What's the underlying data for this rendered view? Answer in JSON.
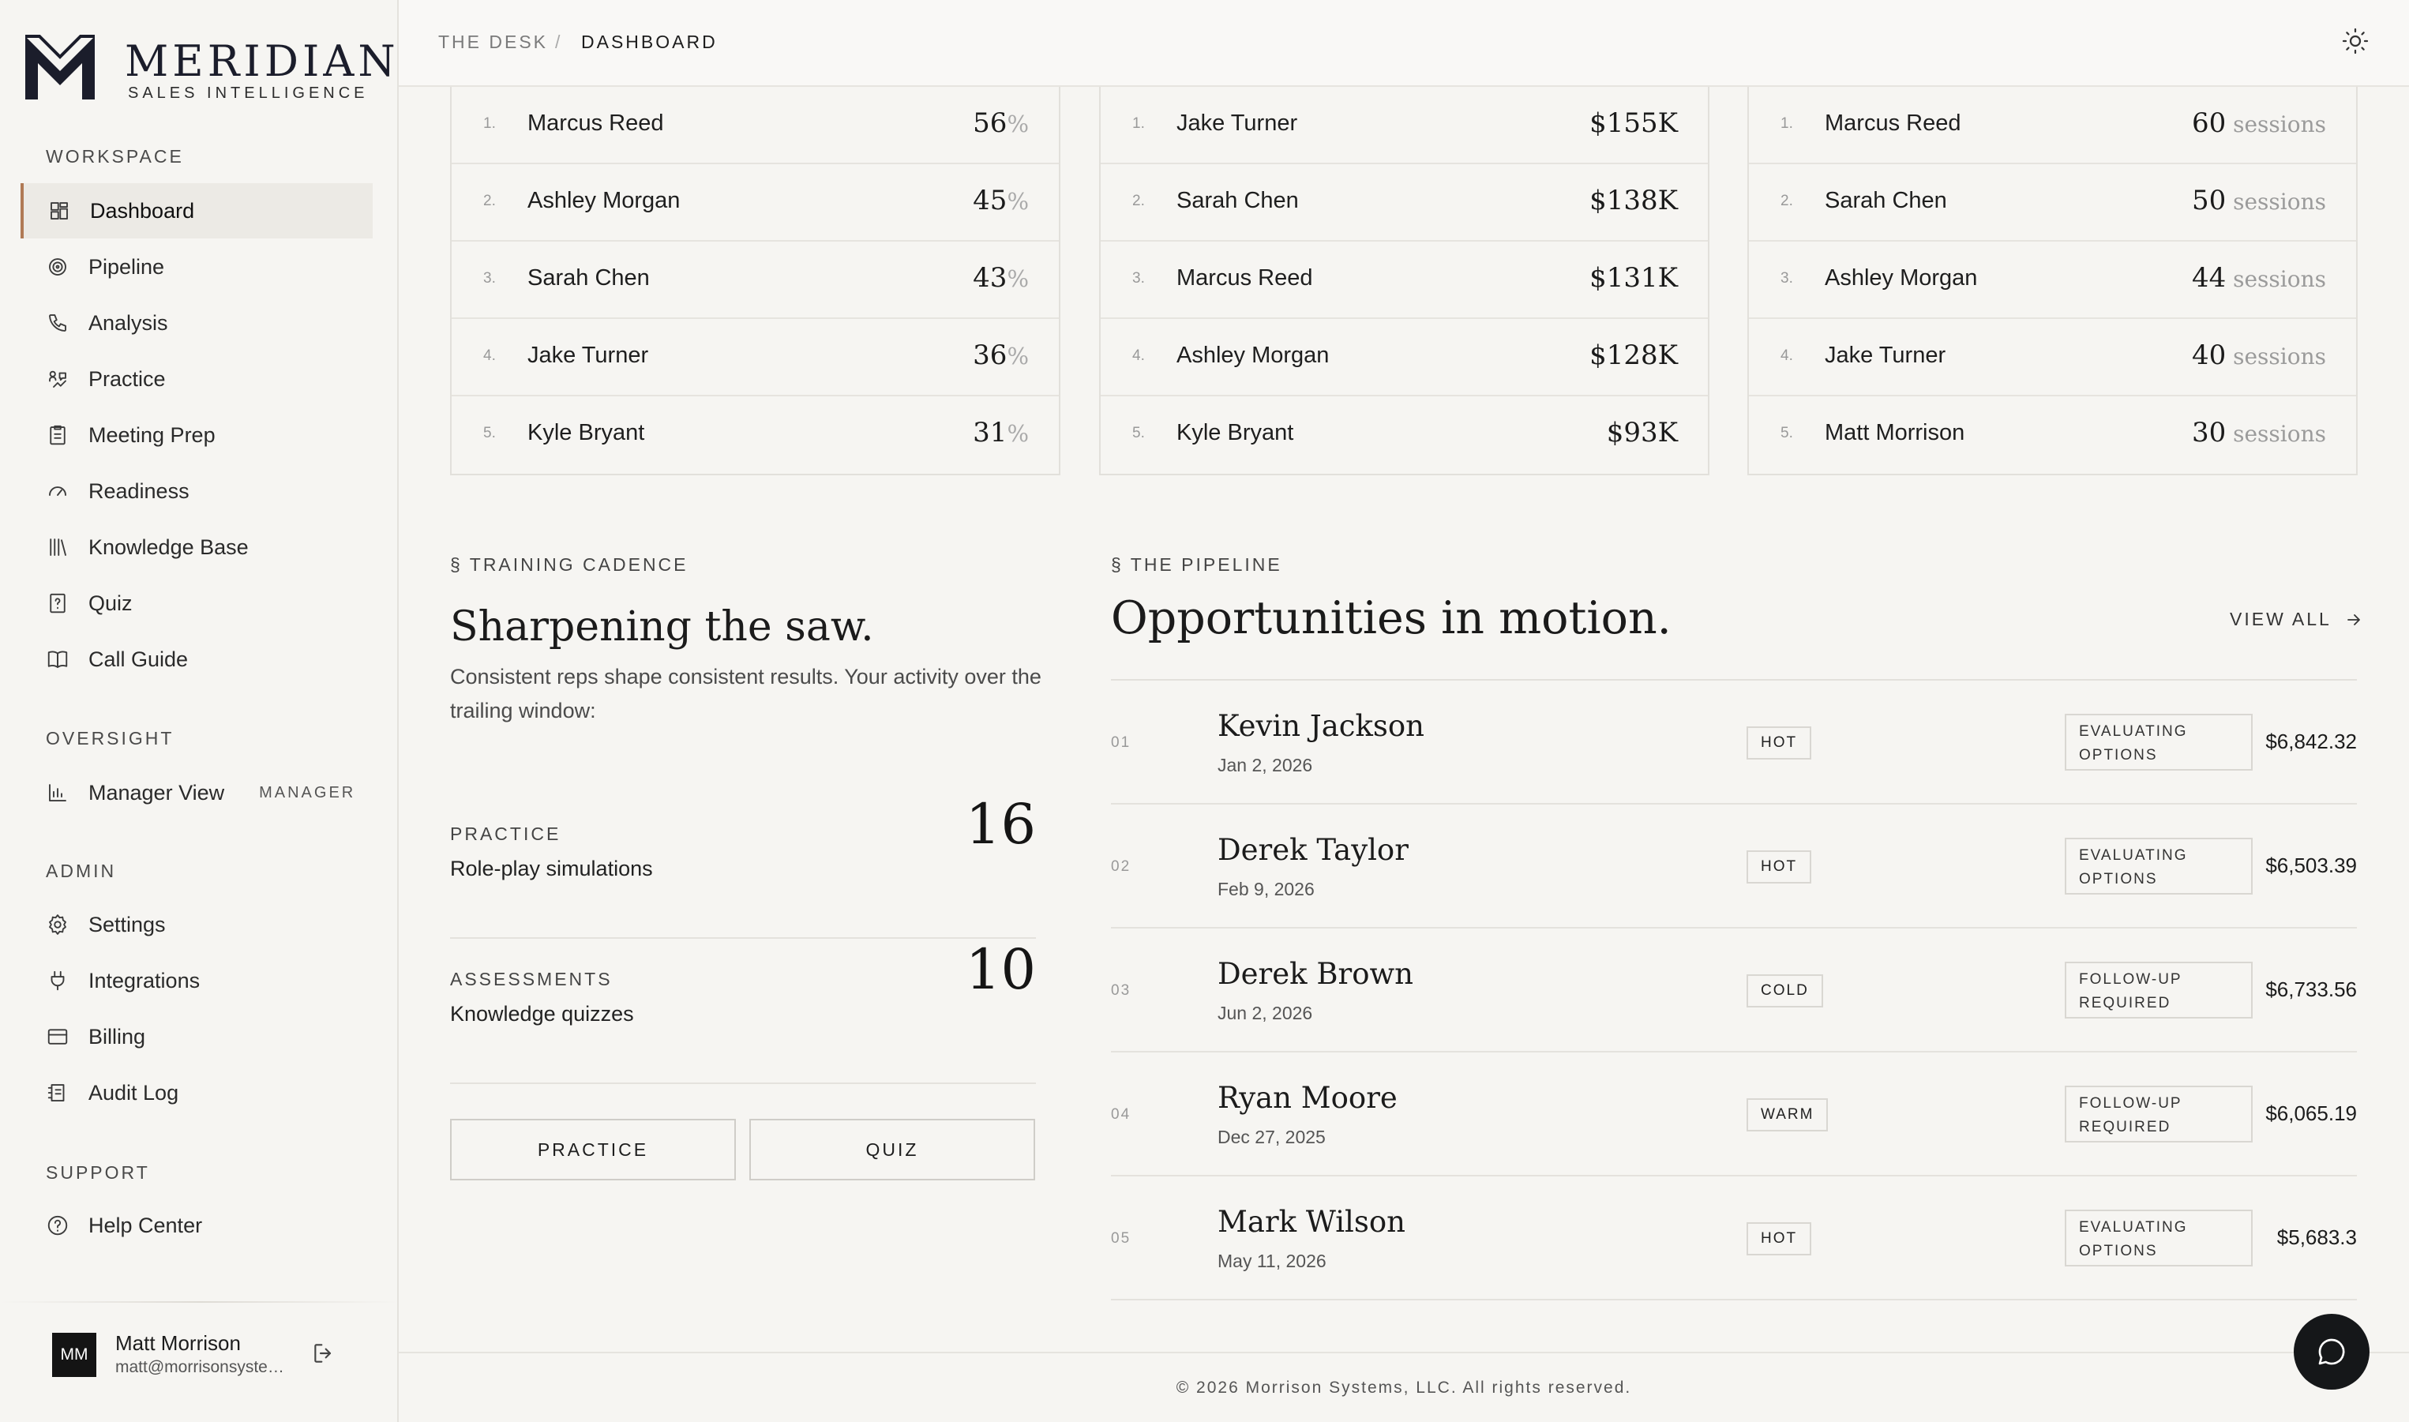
{
  "brand": {
    "name": "MERIDIAN",
    "tagline": "SALES INTELLIGENCE"
  },
  "sidebar": {
    "workspace_label": "WORKSPACE",
    "workspace": [
      {
        "label": "Dashboard",
        "icon": "dashboard-icon",
        "active": true
      },
      {
        "label": "Pipeline",
        "icon": "target-icon"
      },
      {
        "label": "Analysis",
        "icon": "phone-icon"
      },
      {
        "label": "Practice",
        "icon": "practice-icon"
      },
      {
        "label": "Meeting Prep",
        "icon": "clipboard-icon"
      },
      {
        "label": "Readiness",
        "icon": "gauge-icon"
      },
      {
        "label": "Knowledge Base",
        "icon": "library-icon"
      },
      {
        "label": "Quiz",
        "icon": "quiz-icon"
      },
      {
        "label": "Call Guide",
        "icon": "book-icon"
      }
    ],
    "oversight_label": "OVERSIGHT",
    "oversight": [
      {
        "label": "Manager View",
        "icon": "bar-chart-icon",
        "badge": "MANAGER"
      }
    ],
    "admin_label": "ADMIN",
    "admin": [
      {
        "label": "Settings",
        "icon": "gear-icon"
      },
      {
        "label": "Integrations",
        "icon": "plug-icon"
      },
      {
        "label": "Billing",
        "icon": "credit-card-icon"
      },
      {
        "label": "Audit Log",
        "icon": "audit-log-icon"
      }
    ],
    "support_label": "SUPPORT",
    "support": [
      {
        "label": "Help Center",
        "icon": "help-icon"
      }
    ],
    "user": {
      "initials": "MM",
      "name": "Matt Morrison",
      "email": "matt@morrisonsystems.com"
    }
  },
  "topbar": {
    "crumb_root": "THE DESK",
    "separator": "/",
    "crumb_current": "DASHBOARD",
    "theme_icon": "sun-icon"
  },
  "leaderboards": [
    {
      "rows": [
        {
          "rank": "1.",
          "name": "Marcus Reed",
          "value": "56",
          "unit": "%"
        },
        {
          "rank": "2.",
          "name": "Ashley Morgan",
          "value": "45",
          "unit": "%"
        },
        {
          "rank": "3.",
          "name": "Sarah Chen",
          "value": "43",
          "unit": "%"
        },
        {
          "rank": "4.",
          "name": "Jake Turner",
          "value": "36",
          "unit": "%"
        },
        {
          "rank": "5.",
          "name": "Kyle Bryant",
          "value": "31",
          "unit": "%"
        }
      ]
    },
    {
      "rows": [
        {
          "rank": "1.",
          "name": "Jake Turner",
          "value": "$155K",
          "unit": ""
        },
        {
          "rank": "2.",
          "name": "Sarah Chen",
          "value": "$138K",
          "unit": ""
        },
        {
          "rank": "3.",
          "name": "Marcus Reed",
          "value": "$131K",
          "unit": ""
        },
        {
          "rank": "4.",
          "name": "Ashley Morgan",
          "value": "$128K",
          "unit": ""
        },
        {
          "rank": "5.",
          "name": "Kyle Bryant",
          "value": "$93K",
          "unit": ""
        }
      ]
    },
    {
      "rows": [
        {
          "rank": "1.",
          "name": "Marcus Reed",
          "value": "60",
          "unit": " sessions"
        },
        {
          "rank": "2.",
          "name": "Sarah Chen",
          "value": "50",
          "unit": " sessions"
        },
        {
          "rank": "3.",
          "name": "Ashley Morgan",
          "value": "44",
          "unit": " sessions"
        },
        {
          "rank": "4.",
          "name": "Jake Turner",
          "value": "40",
          "unit": " sessions"
        },
        {
          "rank": "5.",
          "name": "Matt Morrison",
          "value": "30",
          "unit": " sessions"
        }
      ]
    }
  ],
  "training": {
    "eyebrow": "§ TRAINING CADENCE",
    "title": "Sharpening the saw.",
    "body": "Consistent reps shape consistent results. Your activity over the trailing window:",
    "metrics": [
      {
        "label": "PRACTICE",
        "desc": "Role-play simulations",
        "value": "16"
      },
      {
        "label": "ASSESSMENTS",
        "desc": "Knowledge quizzes",
        "value": "10"
      }
    ],
    "practice_button": "PRACTICE",
    "quiz_button": "QUIZ"
  },
  "pipeline": {
    "eyebrow": "§ THE PIPELINE",
    "title": "Opportunities in motion.",
    "view_all": "VIEW ALL",
    "rows": [
      {
        "idx": "01",
        "name": "Kevin Jackson",
        "date": "Jan 2, 2026",
        "temp": "HOT",
        "status": "EVALUATING OPTIONS",
        "amount": "$6,842.32"
      },
      {
        "idx": "02",
        "name": "Derek Taylor",
        "date": "Feb 9, 2026",
        "temp": "HOT",
        "status": "EVALUATING OPTIONS",
        "amount": "$6,503.39"
      },
      {
        "idx": "03",
        "name": "Derek Brown",
        "date": "Jun 2, 2026",
        "temp": "COLD",
        "status": "FOLLOW-UP REQUIRED",
        "amount": "$6,733.56"
      },
      {
        "idx": "04",
        "name": "Ryan Moore",
        "date": "Dec 27, 2025",
        "temp": "WARM",
        "status": "FOLLOW-UP REQUIRED",
        "amount": "$6,065.19"
      },
      {
        "idx": "05",
        "name": "Mark Wilson",
        "date": "May 11, 2026",
        "temp": "HOT",
        "status": "EVALUATING OPTIONS",
        "amount": "$5,683.3"
      }
    ]
  },
  "footer": {
    "copyright": "© 2026 Morrison Systems, LLC. All rights reserved."
  },
  "chat": {
    "icon": "chat-icon"
  }
}
